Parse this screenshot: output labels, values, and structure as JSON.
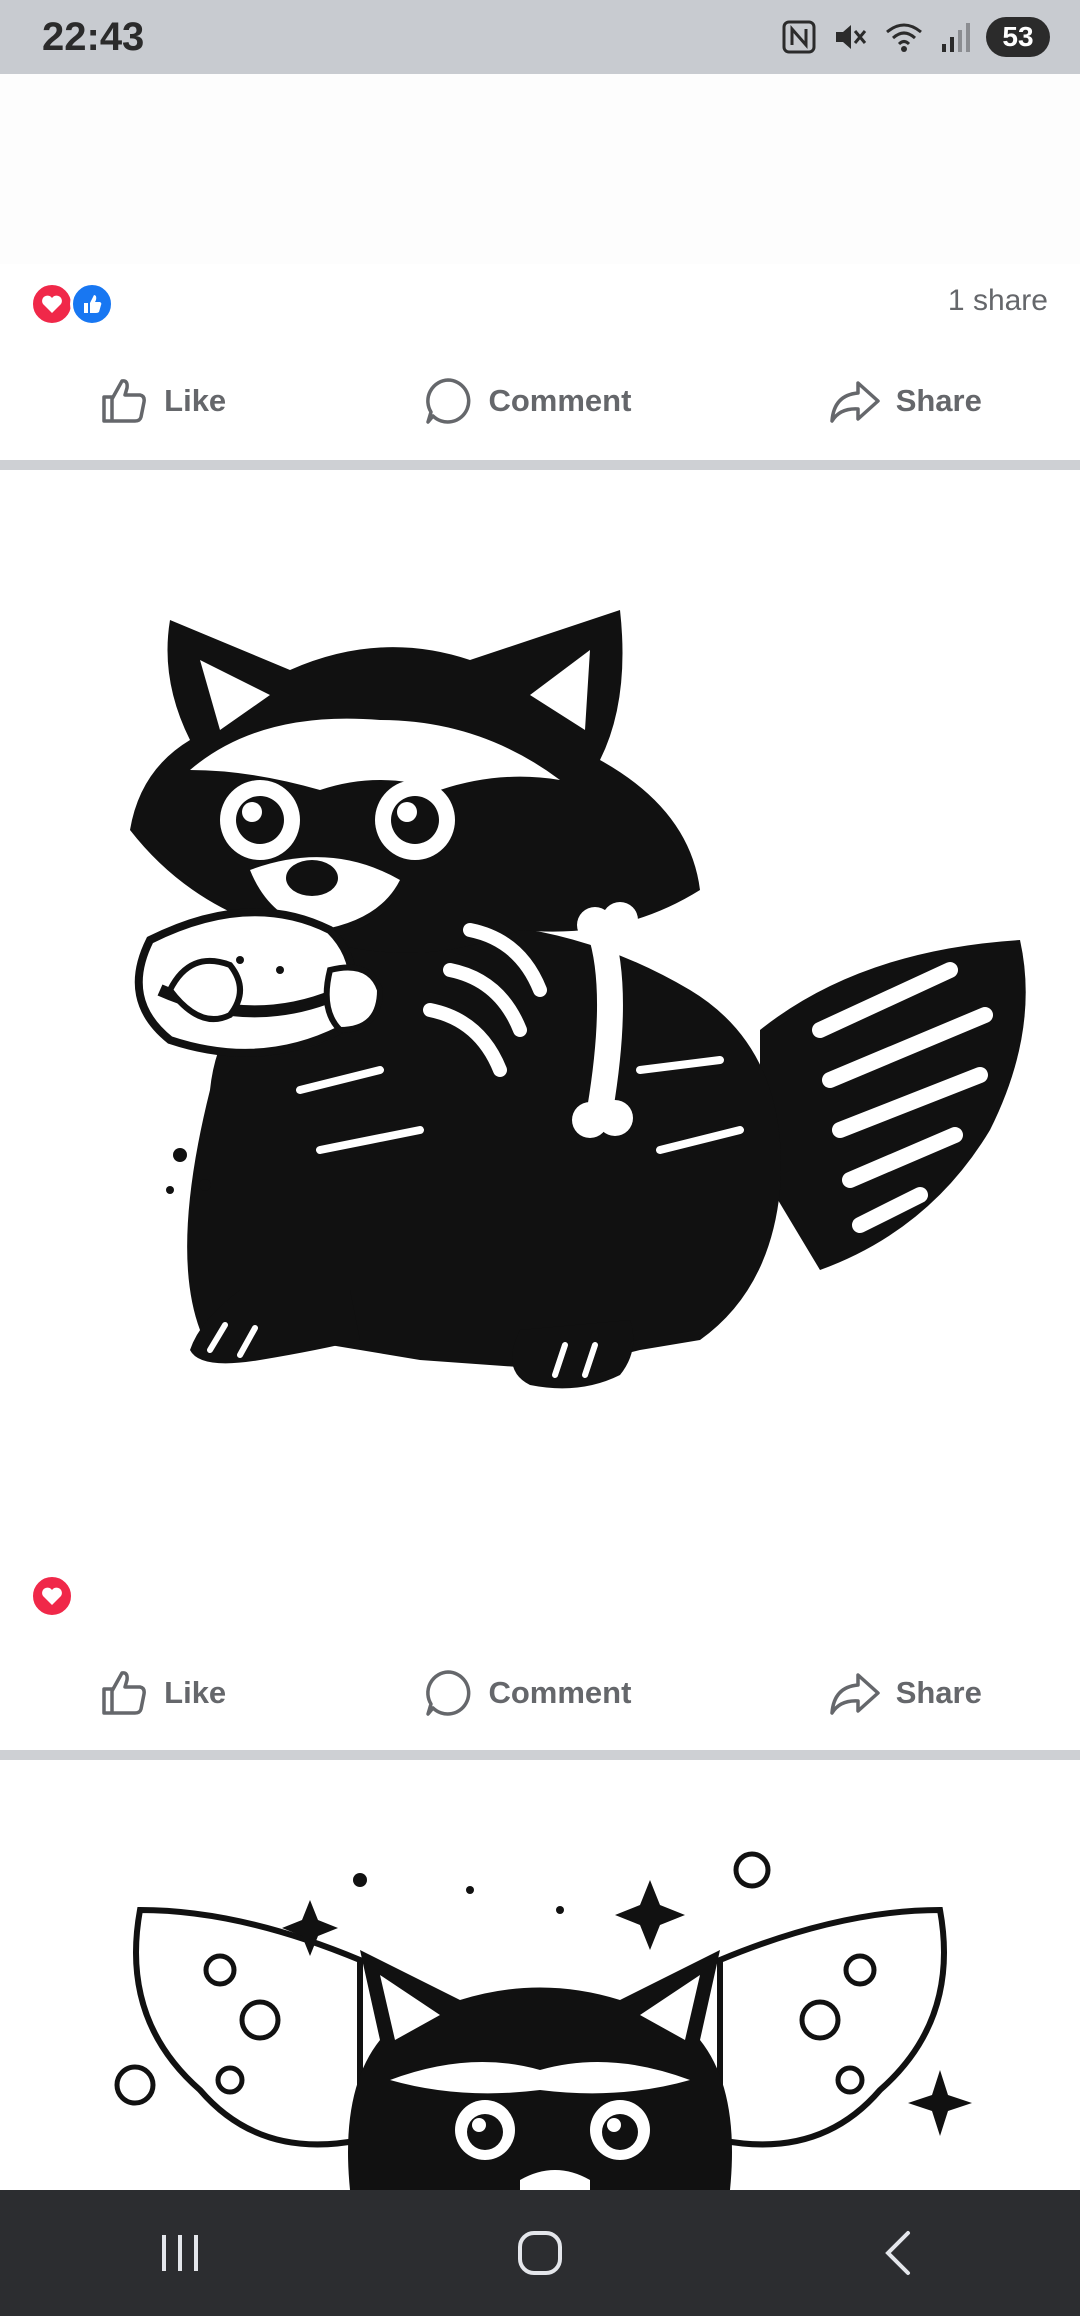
{
  "status_bar": {
    "time": "22:43",
    "battery": "53",
    "icons": [
      "nfc-icon",
      "mute-icon",
      "wifi-icon",
      "signal-icon",
      "battery-icon"
    ]
  },
  "posts": [
    {
      "reactions": [
        "love",
        "like"
      ],
      "share_count": "1 share",
      "actions": {
        "like": "Like",
        "comment": "Comment",
        "share": "Share"
      }
    },
    {
      "image": "skeleton-raccoon-eating-sandwich",
      "reactions": [
        "love"
      ],
      "actions": {
        "like": "Like",
        "comment": "Comment",
        "share": "Share"
      }
    },
    {
      "image": "raccoon-with-butterfly-wings"
    }
  ],
  "nav": [
    "recents-button",
    "home-button",
    "back-button"
  ],
  "colors": {
    "love": "#f02849",
    "like": "#1877f2",
    "text_secondary": "#65676b",
    "divider": "#ced0d4"
  }
}
